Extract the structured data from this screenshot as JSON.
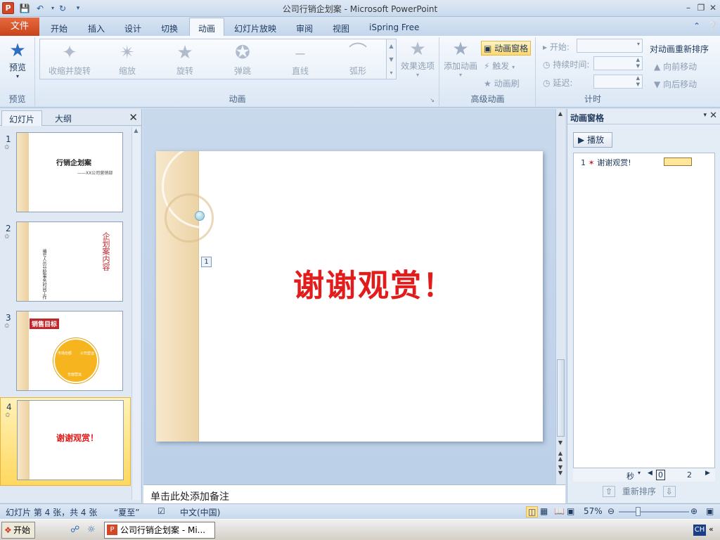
{
  "window": {
    "title": "公司行销企划案 - Microsoft PowerPoint",
    "app_icon": "P"
  },
  "quick_access": {
    "save_icon": "save-icon",
    "undo_icon": "undo-icon",
    "redo_icon": "redo-icon",
    "customize_icon": "dropdown-icon"
  },
  "tabs": {
    "file": "文件",
    "items": [
      "开始",
      "插入",
      "设计",
      "切换",
      "动画",
      "幻灯片放映",
      "审阅",
      "视图",
      "iSpring Free"
    ],
    "active": "动画"
  },
  "ribbon": {
    "preview": {
      "label": "预览",
      "group": "预览"
    },
    "animation_group": {
      "label": "动画",
      "effects": [
        "收缩并旋转",
        "缩放",
        "旋转",
        "弹跳",
        "直线",
        "弧形"
      ],
      "effect_options": "效果选项"
    },
    "advanced": {
      "label": "高级动画",
      "add_animation": "添加动画",
      "animation_pane": "动画窗格",
      "trigger": "触发",
      "animation_painter": "动画刷"
    },
    "timing": {
      "label": "计时",
      "start": "开始:",
      "duration": "持续时间:",
      "delay": "延迟:",
      "reorder_title": "对动画重新排序",
      "move_earlier": "向前移动",
      "move_later": "向后移动"
    }
  },
  "left_panel": {
    "tab_slides": "幻灯片",
    "tab_outline": "大纲",
    "thumbs": [
      {
        "num": "1",
        "title": "行销企划案",
        "subtitle": "——XX公司营销部"
      },
      {
        "num": "2",
        "title": "企划案内容",
        "cols": [
          "编号",
          "人员",
          "分配",
          "事务",
          "时间",
          "工作"
        ]
      },
      {
        "num": "3",
        "title": "销售目标",
        "labels": [
          "市场份额",
          "公司营运",
          "全面营运"
        ]
      },
      {
        "num": "4",
        "title": "谢谢观赏！"
      }
    ]
  },
  "slide": {
    "main_text": "谢谢观赏！",
    "anim_tag": "1"
  },
  "notes": {
    "placeholder": "单击此处添加备注"
  },
  "animation_pane": {
    "title": "动画窗格",
    "play": "播放",
    "items": [
      {
        "num": "1",
        "label": "谢谢观赏!"
      }
    ],
    "seconds": "秒",
    "timeline_marks": [
      "0",
      "2"
    ],
    "reorder": "重新排序"
  },
  "status": {
    "slide_info": "幻灯片 第 4 张，共 4 张",
    "theme": "“夏至”",
    "language": "中文(中国)",
    "zoom": "57%"
  },
  "taskbar": {
    "start": "开始",
    "task": "公司行销企划案 - Mi...",
    "ime": "CH"
  }
}
